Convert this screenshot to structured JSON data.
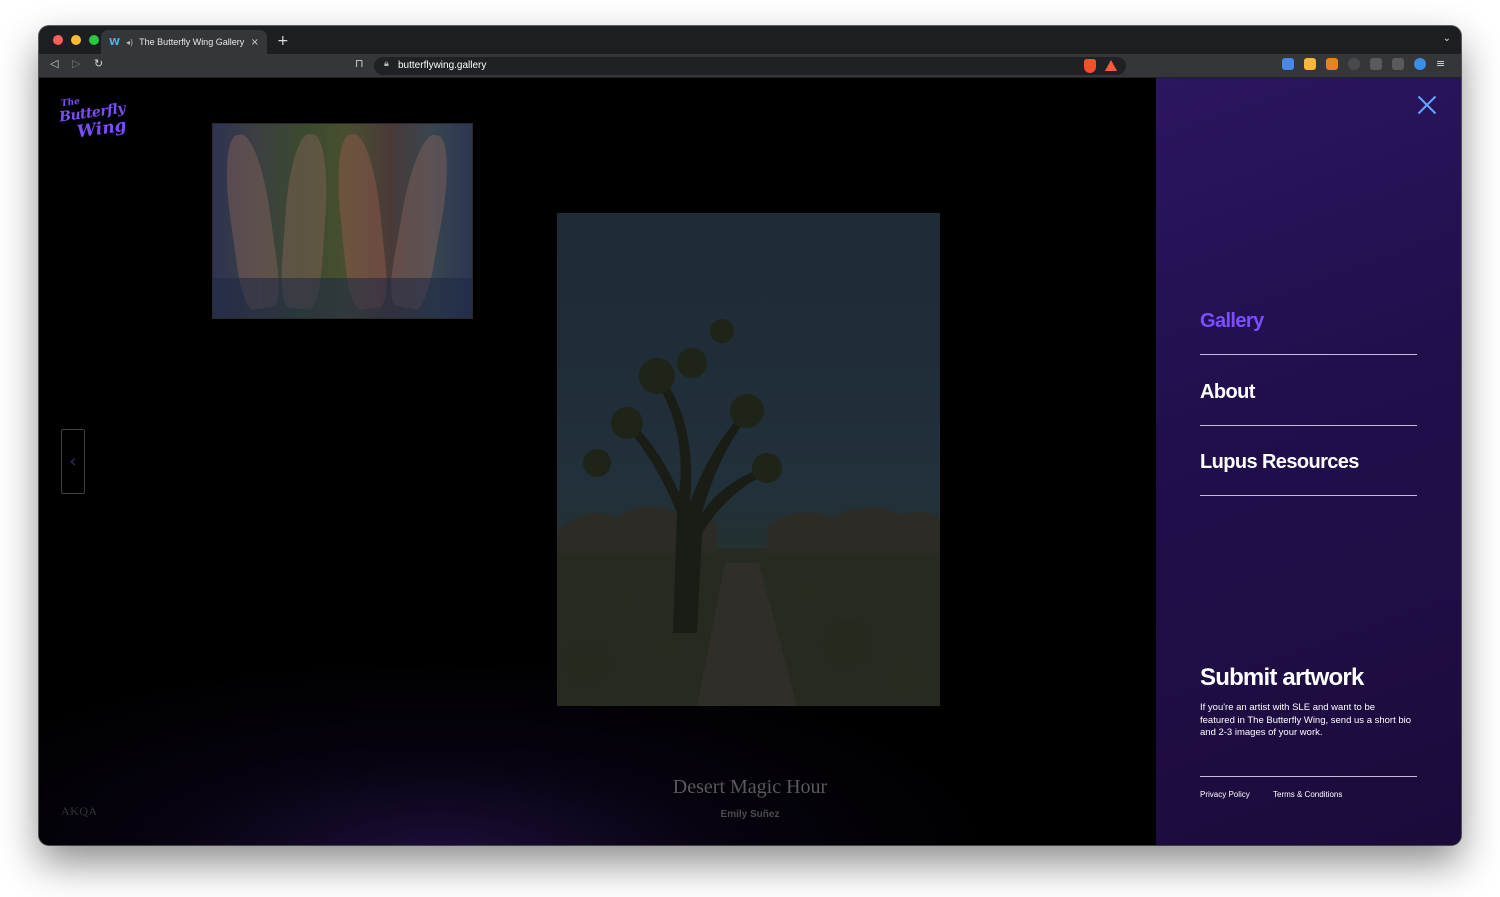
{
  "browser": {
    "tab_title": "The Butterfly Wing Gallery",
    "url": "butterflywing.gallery",
    "new_tab": "+",
    "tab_close": "×"
  },
  "site": {
    "logo_line1": "The",
    "logo_line2": "Butterfly",
    "logo_line3": "Wing",
    "prev_arrow": "‹",
    "sponsor": "AKQA"
  },
  "artwork": {
    "title": "Desert Magic Hour",
    "artist": "Emily Suñez"
  },
  "menu": {
    "items": [
      {
        "label": "Gallery",
        "active": true
      },
      {
        "label": "About",
        "active": false
      },
      {
        "label": "Lupus Resources",
        "active": false
      }
    ],
    "submit_heading": "Submit artwork",
    "submit_text": "If you're an artist with SLE and want to be featured in The Butterfly Wing, send us a short bio and 2-3 images of your work.",
    "privacy": "Privacy Policy",
    "terms": "Terms & Conditions"
  },
  "colors": {
    "accent": "#7b4fff",
    "panel": "#210f4d",
    "close_icon": "#62a6ff"
  },
  "icons": [
    "back-icon",
    "forward-icon",
    "reload-icon",
    "bookmark-icon",
    "lock-icon",
    "brave-shield-icon",
    "bat-rewards-icon",
    "close-icon",
    "chevron-left-icon"
  ]
}
